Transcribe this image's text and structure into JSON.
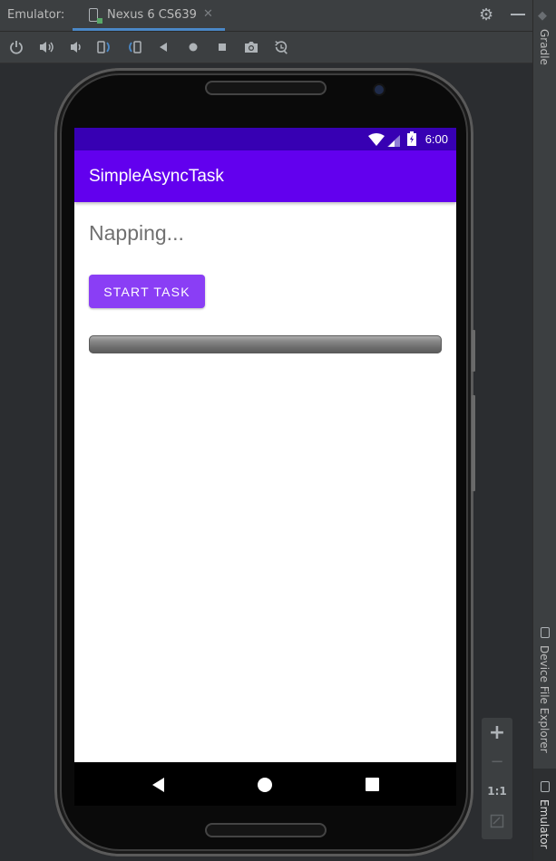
{
  "tabbar": {
    "label": "Emulator:",
    "tab_title": "Nexus 6 CS639",
    "close_glyph": "✕",
    "settings_icon": "gear-icon",
    "minimize_icon": "minimize-icon"
  },
  "toolbar": {
    "icons": [
      "power-icon",
      "volume-up-icon",
      "volume-down-icon",
      "rotate-left-icon",
      "rotate-right-icon",
      "back-icon",
      "home-icon",
      "overview-icon",
      "screenshot-icon",
      "snapshot-icon"
    ]
  },
  "side": {
    "gradle_label": "Gradle",
    "device_file_explorer_label": "Device File Explorer",
    "emulator_label": "Emulator"
  },
  "phone": {
    "status_time": "6:00",
    "app_title": "SimpleAsyncTask",
    "status_text": "Napping...",
    "button_label": "START TASK",
    "colors": {
      "status_bar": "#3700b3",
      "app_bar": "#6200ee",
      "button": "#8a3ef5"
    }
  },
  "zoom": {
    "plus": "+",
    "minus": "−",
    "one_to_one": "1:1"
  }
}
